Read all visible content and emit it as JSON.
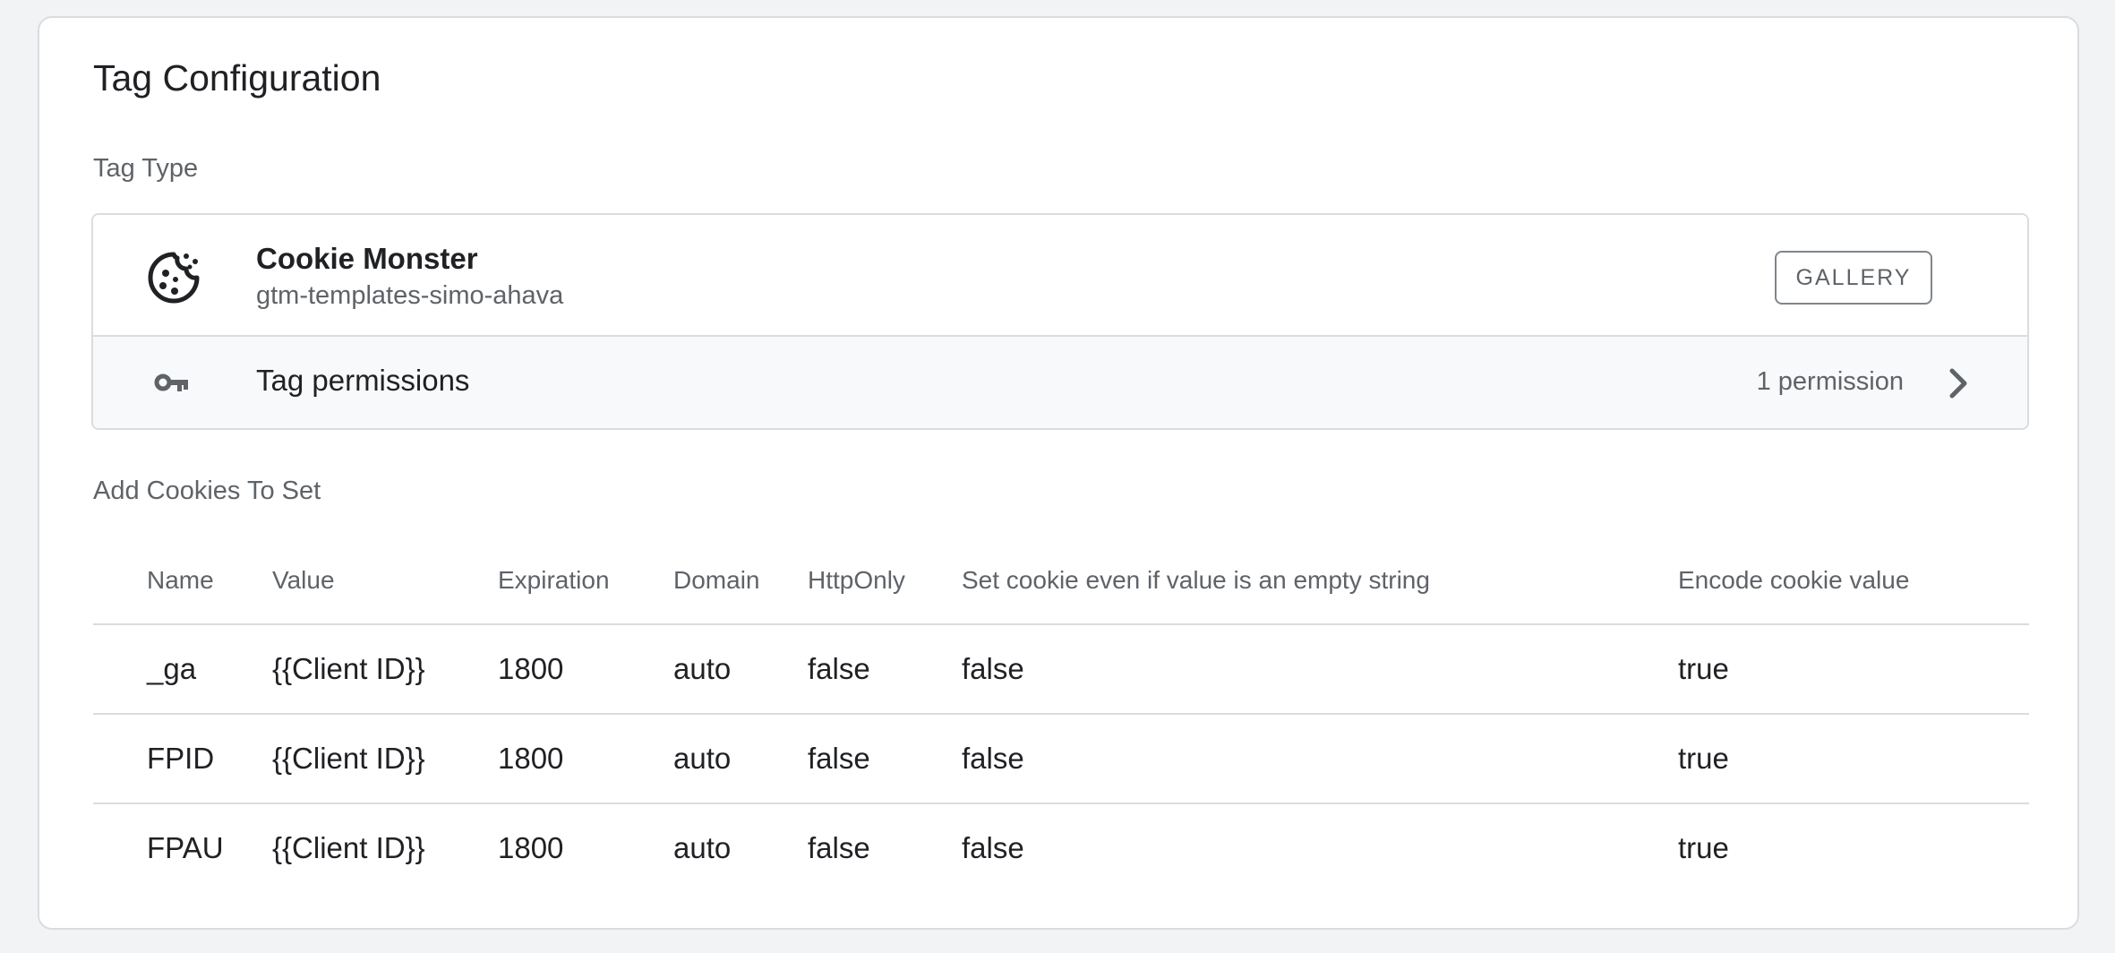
{
  "card": {
    "title": "Tag Configuration",
    "tag_type_label": "Tag Type",
    "cookies_label": "Add Cookies To Set"
  },
  "tag": {
    "icon": "cookie-icon",
    "name": "Cookie Monster",
    "publisher": "gtm-templates-simo-ahava",
    "gallery_label": "GALLERY"
  },
  "permissions": {
    "icon": "key-icon",
    "label": "Tag permissions",
    "count": "1 permission",
    "chevron_icon": "chevron-right-icon"
  },
  "table": {
    "headers": {
      "name": "Name",
      "value": "Value",
      "expiration": "Expiration",
      "domain": "Domain",
      "httponly": "HttpOnly",
      "empty": "Set cookie even if value is an empty string",
      "encode": "Encode cookie value"
    },
    "rows": [
      {
        "name": "_ga",
        "value": "{{Client ID}}",
        "expiration": "1800",
        "domain": "auto",
        "httponly": "false",
        "empty": "false",
        "encode": "true"
      },
      {
        "name": "FPID",
        "value": "{{Client ID}}",
        "expiration": "1800",
        "domain": "auto",
        "httponly": "false",
        "empty": "false",
        "encode": "true"
      },
      {
        "name": "FPAU",
        "value": "{{Client ID}}",
        "expiration": "1800",
        "domain": "auto",
        "httponly": "false",
        "empty": "false",
        "encode": "true"
      }
    ]
  },
  "colors": {
    "text_primary": "#202124",
    "text_secondary": "#5f6368",
    "border": "#dadce0",
    "page_bg": "#f1f3f4",
    "row_bg": "#f8f9fa"
  }
}
